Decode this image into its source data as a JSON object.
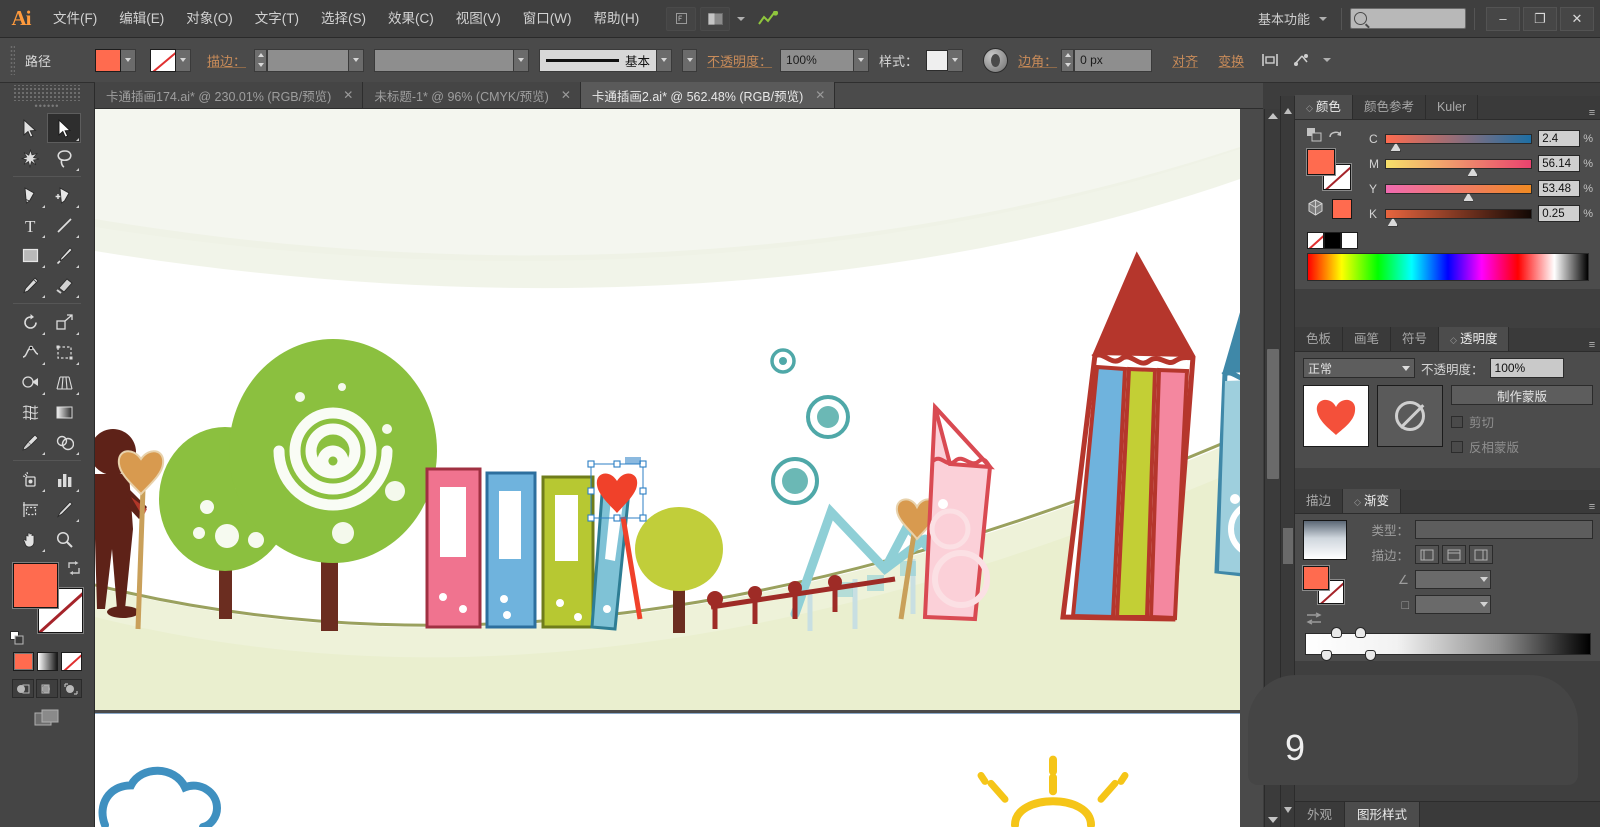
{
  "app": {
    "logo": "Ai",
    "workspace": "基本功能",
    "search_placeholder": ""
  },
  "menu": {
    "items": [
      {
        "label": "文件(F)",
        "name": "menu-file"
      },
      {
        "label": "编辑(E)",
        "name": "menu-edit"
      },
      {
        "label": "对象(O)",
        "name": "menu-object"
      },
      {
        "label": "文字(T)",
        "name": "menu-type"
      },
      {
        "label": "选择(S)",
        "name": "menu-select"
      },
      {
        "label": "效果(C)",
        "name": "menu-effect"
      },
      {
        "label": "视图(V)",
        "name": "menu-view"
      },
      {
        "label": "窗口(W)",
        "name": "menu-window"
      },
      {
        "label": "帮助(H)",
        "name": "menu-help"
      }
    ],
    "bridge_icon": "br-icon",
    "arrange_icon": "arrange-documents-icon",
    "stock_icon": "stock-icon"
  },
  "window_buttons": {
    "minimize": "–",
    "maximize": "❐",
    "close": "✕"
  },
  "options_bar": {
    "object_label": "路径",
    "fill_color": "#ff6b4f",
    "stroke_label": "描边：",
    "stroke_weight": "",
    "stroke_profile": "",
    "brush_label": "基本",
    "opacity_label": "不透明度：",
    "opacity_value": "100%",
    "style_label": "样式：",
    "corner_label": "边角：",
    "corner_value": "0 px",
    "align_label": "对齐",
    "transform_label": "变换",
    "isolate_icon": "isolate-icon",
    "more_icon": "more-options-icon"
  },
  "tabs": [
    {
      "label": "卡通插画174.ai* @ 230.01% (RGB/预览)",
      "active": false,
      "close": "✕"
    },
    {
      "label": "未标题-1* @ 96% (CMYK/预览)",
      "active": false,
      "close": "✕"
    },
    {
      "label": "卡通插画2.ai* @ 562.48% (RGB/预览)",
      "active": true,
      "close": "✕"
    }
  ],
  "toolbar": {
    "header": "••••••",
    "tools": [
      {
        "name": "selection-tool",
        "selected": false
      },
      {
        "name": "direct-selection-tool",
        "selected": true
      },
      {
        "name": "magic-wand-tool",
        "selected": false
      },
      {
        "name": "lasso-tool",
        "selected": false
      },
      {
        "name": "pen-tool",
        "selected": false
      },
      {
        "name": "add-anchor-point-tool",
        "selected": false
      },
      {
        "name": "type-tool",
        "selected": false
      },
      {
        "name": "line-segment-tool",
        "selected": false
      },
      {
        "name": "rectangle-tool",
        "selected": false
      },
      {
        "name": "paintbrush-tool",
        "selected": false
      },
      {
        "name": "pencil-tool",
        "selected": false
      },
      {
        "name": "blob-brush-tool",
        "selected": false
      },
      {
        "name": "rotate-tool",
        "selected": false
      },
      {
        "name": "scale-tool",
        "selected": false
      },
      {
        "name": "width-tool",
        "selected": false
      },
      {
        "name": "free-transform-tool",
        "selected": false
      },
      {
        "name": "shape-builder-tool",
        "selected": false
      },
      {
        "name": "perspective-grid-tool",
        "selected": false
      },
      {
        "name": "mesh-tool",
        "selected": false
      },
      {
        "name": "gradient-tool",
        "selected": false
      },
      {
        "name": "eyedropper-tool",
        "selected": false
      },
      {
        "name": "blend-tool",
        "selected": false
      },
      {
        "name": "symbol-sprayer-tool",
        "selected": false
      },
      {
        "name": "column-graph-tool",
        "selected": false
      },
      {
        "name": "artboard-tool",
        "selected": false
      },
      {
        "name": "slice-tool",
        "selected": false
      },
      {
        "name": "hand-tool",
        "selected": false
      },
      {
        "name": "zoom-tool",
        "selected": false
      }
    ],
    "fill_color": "#ff6b4f",
    "stroke_color": "#ffffff",
    "screen_mode_icon": "screen-mode-icon"
  },
  "color_panel": {
    "tabs": [
      {
        "label": "颜色",
        "active": true
      },
      {
        "label": "颜色参考",
        "active": false
      },
      {
        "label": "Kuler",
        "active": false
      }
    ],
    "fill_color": "#ff6b4f",
    "mode": "CMYK",
    "channels": [
      {
        "label": "C",
        "value": "2.4",
        "unit": "%",
        "pos": 3
      },
      {
        "label": "M",
        "value": "56.14",
        "unit": "%",
        "pos": 56
      },
      {
        "label": "Y",
        "value": "53.48",
        "unit": "%",
        "pos": 53
      },
      {
        "label": "K",
        "value": "0.25",
        "unit": "%",
        "pos": 1
      }
    ]
  },
  "transparency_panel": {
    "tabs": [
      {
        "label": "色板",
        "active": false
      },
      {
        "label": "画笔",
        "active": false
      },
      {
        "label": "符号",
        "active": false
      },
      {
        "label": "透明度",
        "active": true
      }
    ],
    "blend_mode": "正常",
    "opacity_label": "不透明度：",
    "opacity_value": "100%",
    "make_mask_button": "制作蒙版",
    "clip_checkbox": "剪切",
    "invert_mask_checkbox": "反相蒙版",
    "thumbnail": "heart-thumbnail",
    "mask_thumbnail": "no-mask-icon"
  },
  "gradient_panel": {
    "tabs": [
      {
        "label": "描边",
        "active": false
      },
      {
        "label": "渐变",
        "active": true
      }
    ],
    "type_label": "类型：",
    "stroke_label": "描边：",
    "angle_label": "∠",
    "location_label": "□",
    "type_value": "",
    "angle_value": "",
    "location_value": ""
  },
  "bottom_panel_tabs": [
    {
      "label": "外观",
      "active": false
    },
    {
      "label": "图形样式",
      "active": true
    }
  ],
  "overlay": {
    "text": "9"
  },
  "canvas": {
    "artboard1_name": "artboard-1",
    "artboard2_name": "artboard-2",
    "selected_object": "heart-shape-selected",
    "palette": {
      "tree_green": "#8bc03f",
      "tree_green_light": "#7fbc3f",
      "trunk_brown": "#6b2d20",
      "book_pink": "#f0738f",
      "book_blue": "#6fb3dd",
      "book_olive": "#b7c832",
      "book_teal": "#7fc2d6",
      "pencil_red": "#b5362c",
      "pencil_blue": "#6fb3dd",
      "pencil_yellow": "#c3cf35",
      "pencil_pink": "#f4879f",
      "pencil_teal": "#3f88a8",
      "ground_green": "#e8eecd",
      "ground_line": "#9aa15e",
      "bubble_teal": "#4fa8a8",
      "house_teal": "#8fcfd6",
      "fence_red": "#9e2b26",
      "figure_brown": "#5e2218",
      "sun_yellow": "#f5c518",
      "cloud_blue": "#3f90c0",
      "heart_red": "#f0412a",
      "heart_tan": "#d89a4f"
    }
  }
}
